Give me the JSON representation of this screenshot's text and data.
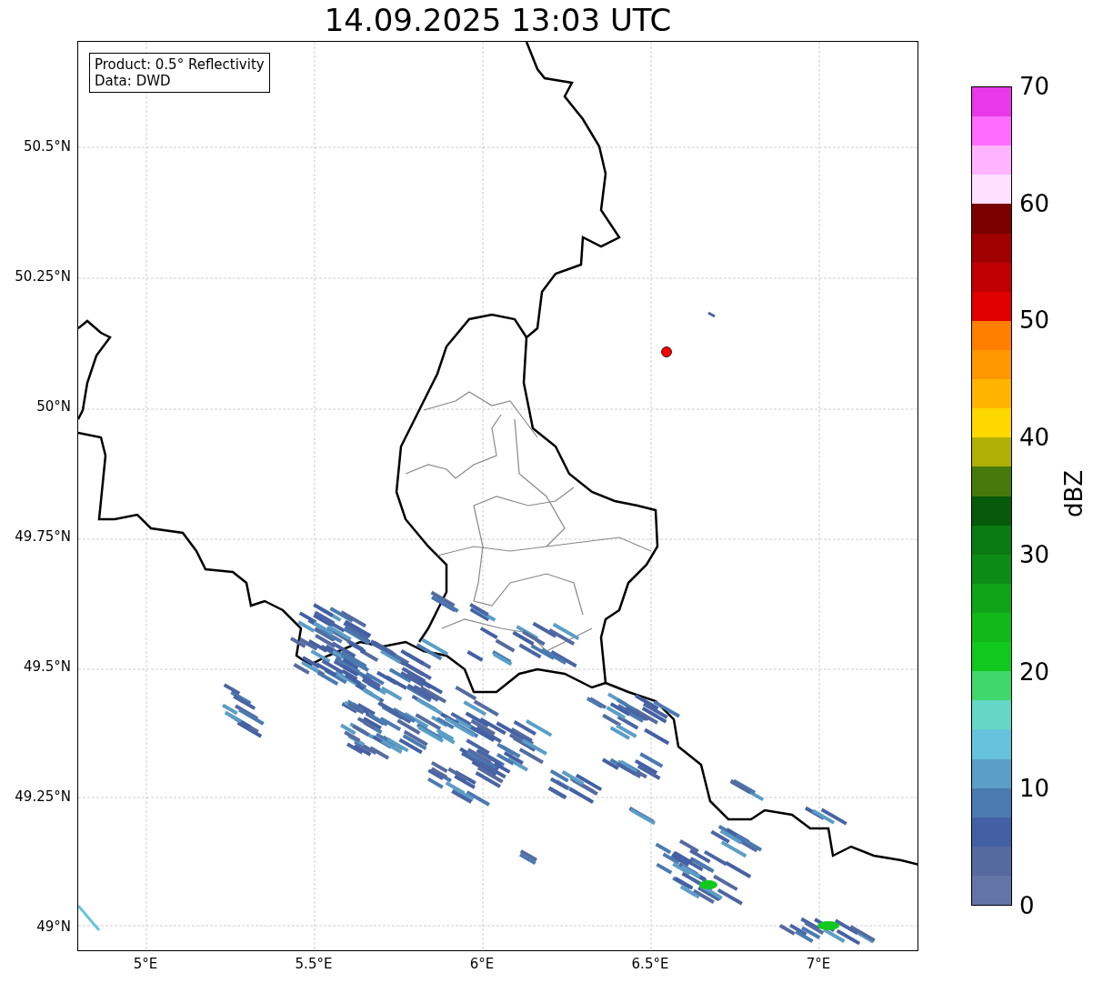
{
  "title": "14.09.2025 13:03 UTC",
  "info_box": [
    "Product: 0.5° Reflectivity",
    "Data: DWD"
  ],
  "map": {
    "lat_labels": [
      "50.5°N",
      "50.25°N",
      "50°N",
      "49.75°N",
      "49.5°N",
      "49.25°N",
      "49°N"
    ],
    "lon_labels": [
      "5°E",
      "5.5°E",
      "6°E",
      "6.5°E",
      "7°E"
    ]
  },
  "colorbar": {
    "label": "dBZ",
    "ticks": [
      "70",
      "60",
      "50",
      "40",
      "30",
      "20",
      "10",
      "0"
    ],
    "segments": [
      {
        "color": "#e838e8"
      },
      {
        "color": "#ff6cff"
      },
      {
        "color": "#ffb4ff"
      },
      {
        "color": "#ffe0ff"
      },
      {
        "color": "#7a0000"
      },
      {
        "color": "#a00000"
      },
      {
        "color": "#c00000"
      },
      {
        "color": "#e00000"
      },
      {
        "color": "#ff8000"
      },
      {
        "color": "#ff9800"
      },
      {
        "color": "#ffb400"
      },
      {
        "color": "#ffd800"
      },
      {
        "color": "#b0b004"
      },
      {
        "color": "#467a0a"
      },
      {
        "color": "#065a0a"
      },
      {
        "color": "#0a7a12"
      },
      {
        "color": "#0c8c14"
      },
      {
        "color": "#10a418"
      },
      {
        "color": "#12b81a"
      },
      {
        "color": "#10c81e"
      },
      {
        "color": "#3fd86c"
      },
      {
        "color": "#64d8c4"
      },
      {
        "color": "#67c3dc"
      },
      {
        "color": "#5b9ec6"
      },
      {
        "color": "#4a7ab0"
      },
      {
        "color": "#4460a4"
      },
      {
        "color": "#556ba0"
      },
      {
        "color": "#6374a6"
      }
    ]
  }
}
